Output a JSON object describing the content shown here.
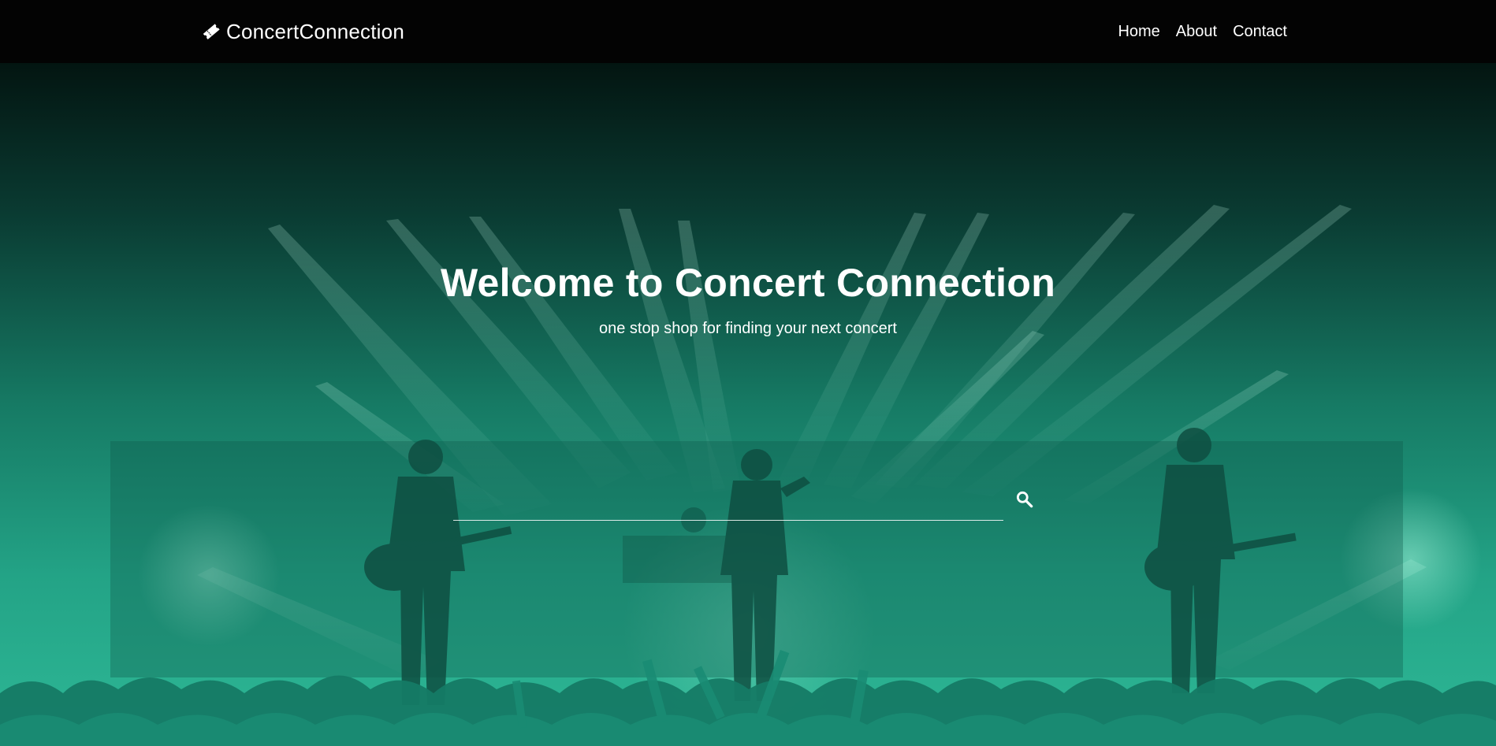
{
  "navbar": {
    "brand": {
      "icon": "ticket-icon",
      "label": "ConcertConnection"
    },
    "links": [
      {
        "label": "Home"
      },
      {
        "label": "About"
      },
      {
        "label": "Contact"
      }
    ]
  },
  "hero": {
    "title": "Welcome to Concert Connection",
    "subtitle": "one stop shop for finding your next concert",
    "search": {
      "value": "",
      "placeholder": "",
      "icon": "search-icon"
    },
    "background": "concert-crowd-stage-lights-photo"
  },
  "colors": {
    "navbar_bg": "#030303",
    "hero_overlay_top": "#031511",
    "hero_overlay_bottom": "#2eb896",
    "text": "#ffffff"
  }
}
